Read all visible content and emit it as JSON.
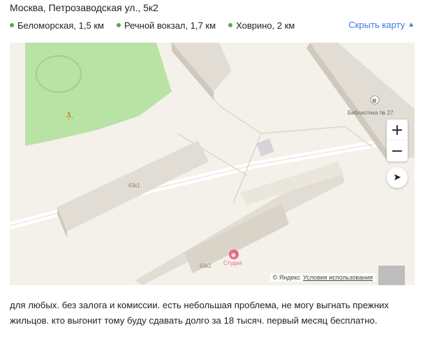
{
  "address": "Москва, Петрозаводская ул., 5к2",
  "metro": [
    {
      "name": "Беломорская, 1,5 км",
      "color": "#4caf50"
    },
    {
      "name": "Речной вокзал, 1,7 км",
      "color": "#4caf50"
    },
    {
      "name": "Ховрино, 2 км",
      "color": "#4caf50"
    }
  ],
  "hide_map": {
    "label": "Скрыть карту",
    "icon": "chevron-up-icon"
  },
  "map": {
    "buildings": {
      "b1": "63к1",
      "b2": "63к2"
    },
    "library_label": "Библиотека № 27",
    "poi_studio_label": "Студия",
    "zoom_in": "+",
    "zoom_out": "−",
    "locate_icon": "navigation-arrow-icon",
    "yandex_label": "© Яндекс",
    "terms_label": "Условия использования",
    "park_color": "#b8e3a4"
  },
  "description": "для любых. без залога и комиссии. есть небольшая проблема, не могу выгнать прежних жильцов. кто выгонит тому буду сдавать долго за 18 тысяч. первый месяц бесплатно."
}
